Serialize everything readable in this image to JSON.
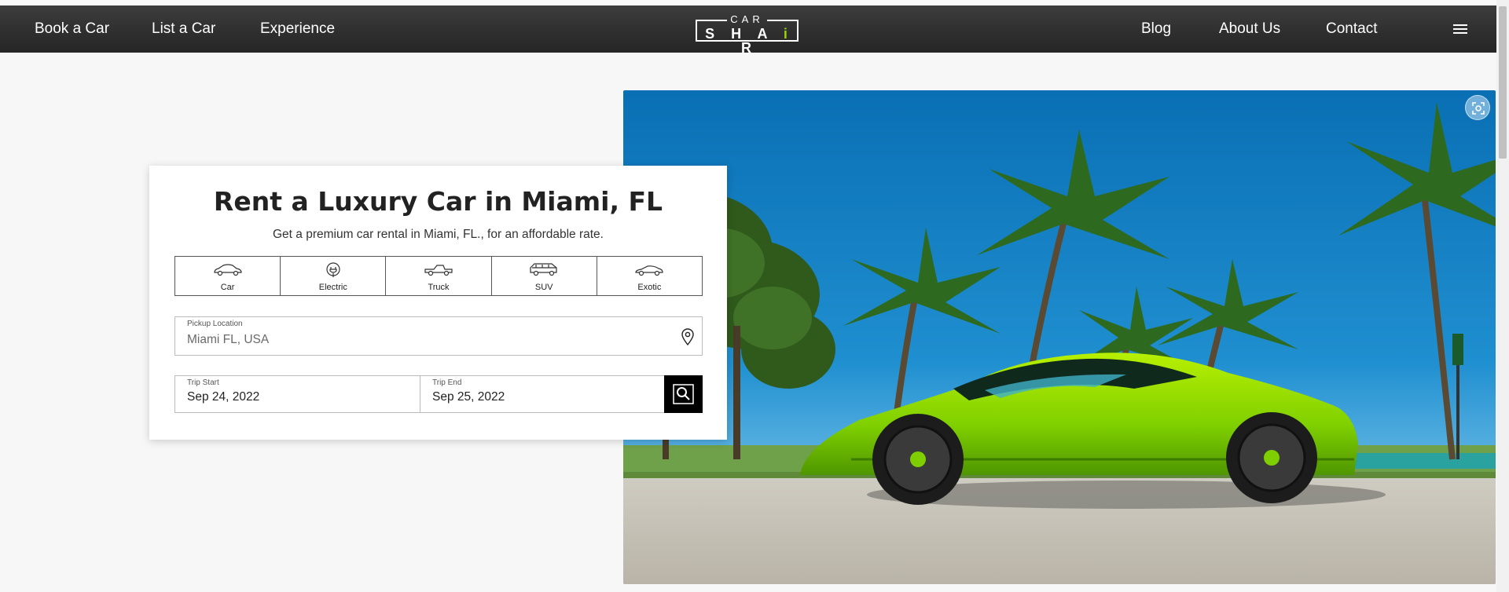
{
  "nav": {
    "left_links": [
      "Book a Car",
      "List a Car",
      "Experience"
    ],
    "right_links": [
      "Blog",
      "About Us",
      "Contact"
    ],
    "logo": {
      "top": "CAR",
      "bottom": "SHAiR"
    },
    "menu_icon": "hamburger-menu-icon"
  },
  "hero_image": {
    "subject": "green convertible sports car under palm trees",
    "icon_fullscreen": "fullscreen-icon"
  },
  "search_card": {
    "title": "Rent a Luxury Car in Miami, FL",
    "subtitle": "Get a premium car rental in Miami, FL., for an affordable rate.",
    "vehicle_types": [
      {
        "label": "Car",
        "icon": "car-icon"
      },
      {
        "label": "Electric",
        "icon": "electric-plug-icon"
      },
      {
        "label": "Truck",
        "icon": "truck-icon"
      },
      {
        "label": "SUV",
        "icon": "suv-icon"
      },
      {
        "label": "Exotic",
        "icon": "exotic-car-icon"
      }
    ],
    "pickup": {
      "label": "Pickup Location",
      "value": "Miami FL, USA",
      "icon": "location-pin-icon"
    },
    "trip_start": {
      "label": "Trip Start",
      "value": "Sep 24, 2022"
    },
    "trip_end": {
      "label": "Trip End",
      "value": "Sep 25, 2022"
    },
    "search_icon": "search-icon"
  },
  "colors": {
    "nav_bg": "#2e2e2e",
    "accent_green": "#9bd400",
    "search_btn": "#000000"
  }
}
